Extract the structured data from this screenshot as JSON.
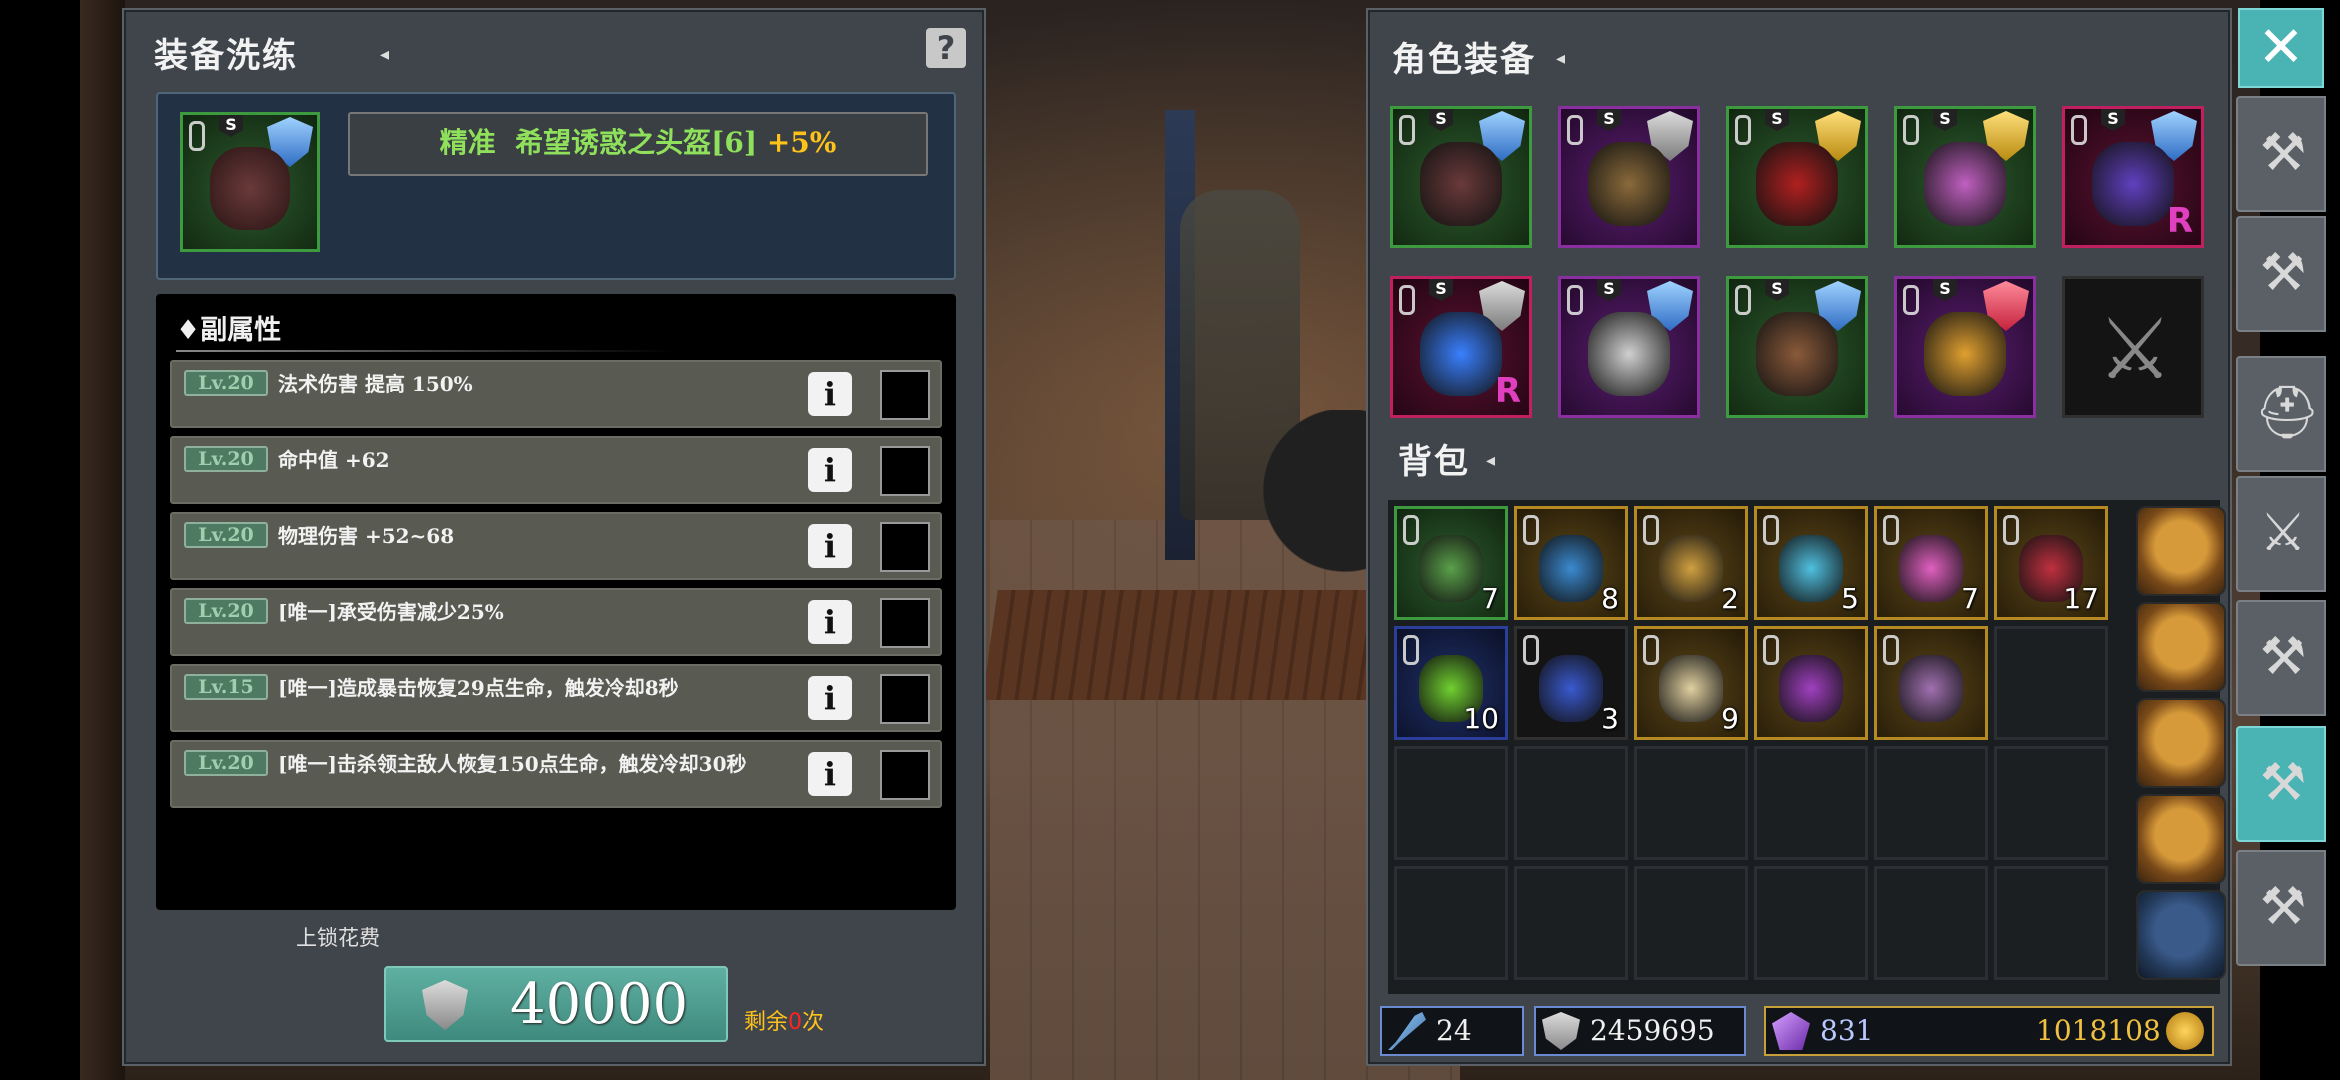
{
  "refine": {
    "title": "装备洗练",
    "help": "?",
    "item": {
      "quality": "精准",
      "name": "希望诱惑之头盔[6]",
      "enhance": "+5%"
    },
    "sub_attr_title": "♦副属性",
    "attrs": [
      {
        "lv": "Lv.20",
        "text": "法术伤害 提高 150%"
      },
      {
        "lv": "Lv.20",
        "text": "命中值 +62"
      },
      {
        "lv": "Lv.20",
        "text": "物理伤害 +52~68"
      },
      {
        "lv": "Lv.20",
        "text": "[唯一]承受伤害减少25%"
      },
      {
        "lv": "Lv.15",
        "text": "[唯一]造成暴击恢复29点生命，触发冷却8秒"
      },
      {
        "lv": "Lv.20",
        "text": "[唯一]击杀领主敌人恢复150点生命，触发冷却30秒"
      }
    ],
    "info_label": "i",
    "lock_cost_label": "上锁花费",
    "cost": "40000",
    "remain_prefix": "剩余",
    "remain_count": "0",
    "remain_suffix": "次"
  },
  "equipment": {
    "title": "角色装备",
    "slots": [
      {
        "name": "helmet",
        "rarity": "green",
        "grade": "S",
        "shield": "blue"
      },
      {
        "name": "armor",
        "rarity": "purple",
        "grade": "S",
        "shield": "grey"
      },
      {
        "name": "cloak",
        "rarity": "green",
        "grade": "S",
        "shield": "gold"
      },
      {
        "name": "ring",
        "rarity": "green",
        "grade": "S",
        "shield": "gold"
      },
      {
        "name": "staff",
        "rarity": "red",
        "grade": "S",
        "shield": "blue",
        "mark": "R"
      },
      {
        "name": "necklace",
        "rarity": "red",
        "grade": "S",
        "shield": "grey",
        "mark": "R"
      },
      {
        "name": "gloves",
        "rarity": "purple",
        "grade": "S",
        "shield": "blue"
      },
      {
        "name": "boots",
        "rarity": "green",
        "grade": "S",
        "shield": "blue"
      },
      {
        "name": "ring2",
        "rarity": "purple",
        "grade": "S",
        "shield": "red"
      },
      {
        "name": "weapon-empty",
        "rarity": "dark",
        "grade": "",
        "shield": ""
      }
    ]
  },
  "bag": {
    "title": "背包",
    "items": [
      {
        "name": "herb-jar",
        "rarity": "green",
        "count": "7"
      },
      {
        "name": "blue-scroll",
        "rarity": "gold",
        "count": "8"
      },
      {
        "name": "yellow-scroll",
        "rarity": "gold",
        "count": "2"
      },
      {
        "name": "blue-potion",
        "rarity": "gold",
        "count": "5"
      },
      {
        "name": "pink-potion",
        "rarity": "gold",
        "count": "7"
      },
      {
        "name": "red-vial",
        "rarity": "gold",
        "count": "17"
      },
      {
        "name": "green-potion",
        "rarity": "blue",
        "count": "10"
      },
      {
        "name": "blue-flask",
        "rarity": "dark",
        "count": "3"
      },
      {
        "name": "sand-pile",
        "rarity": "gold",
        "count": "9"
      },
      {
        "name": "purple-gem",
        "rarity": "gold",
        "count": ""
      },
      {
        "name": "purple-dagger",
        "rarity": "gold",
        "count": ""
      }
    ]
  },
  "currency": {
    "wand": "24",
    "shard": "2459695",
    "crystal": "831",
    "gold": "1018108"
  },
  "colors": {
    "accent": "#4ab3b3",
    "quality_green": "#8fe05a",
    "enhance_gold": "#ffc21a",
    "remain_red": "#ff2222"
  },
  "side": {
    "close": "✕",
    "buttons": [
      "hammer-icon",
      "anvil-icon",
      "helmet-icon",
      "sword-shield-icon",
      "hammer-plus-icon",
      "refine-hammer-icon",
      "crossed-hammer-icon"
    ]
  }
}
